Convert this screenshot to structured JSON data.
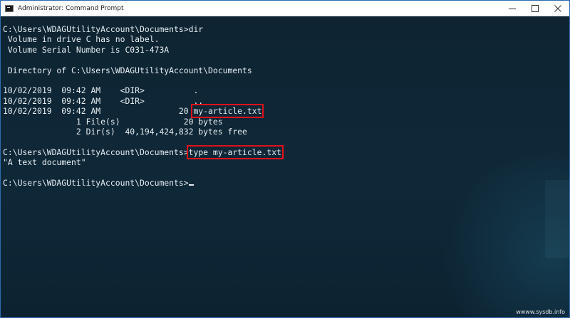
{
  "window": {
    "title": "Administrator: Command Prompt",
    "icon": "cmd-icon",
    "controls": [
      "minimize-icon",
      "maximize-icon",
      "close-icon"
    ]
  },
  "console": {
    "lines": [
      "C:\\Users\\WDAGUtilityAccount\\Documents>dir",
      " Volume in drive C has no label.",
      " Volume Serial Number is C031-473A",
      "",
      " Directory of C:\\Users\\WDAGUtilityAccount\\Documents",
      "",
      "10/02/2019  09:42 AM    <DIR>          .",
      "10/02/2019  09:42 AM    <DIR>          ..",
      "10/02/2019  09:42 AM                20 ",
      "               1 File(s)             20 bytes",
      "               2 Dir(s)  40,194,424,832 bytes free",
      "",
      "C:\\Users\\WDAGUtilityAccount\\Documents>",
      "\"A text document\"",
      "",
      "C:\\Users\\WDAGUtilityAccount\\Documents>"
    ],
    "highlight_filename": "my-article.txt",
    "highlight_command": "type my-article.txt"
  },
  "watermark": "wwww.sysdb.info"
}
